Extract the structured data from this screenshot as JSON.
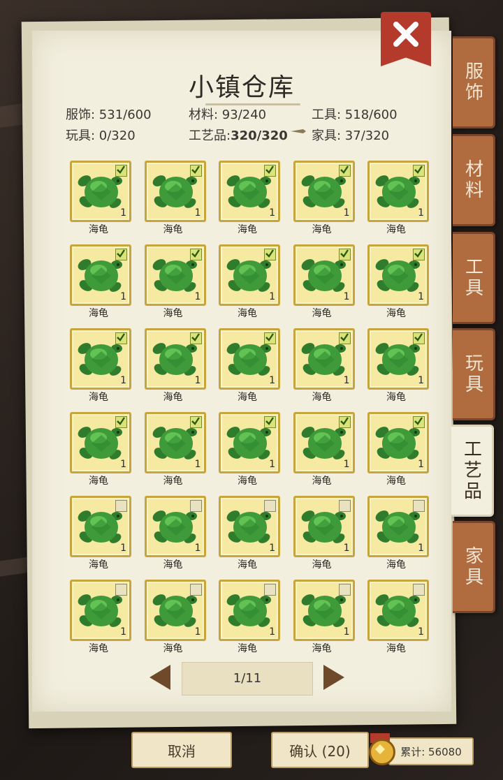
{
  "title": "小镇仓库",
  "stats": [
    {
      "name": "clothing",
      "text": "服饰: 531/600"
    },
    {
      "name": "materials",
      "text": "材料: 93/240"
    },
    {
      "name": "tools",
      "text": "工具: 518/600"
    },
    {
      "name": "toys",
      "text": "玩具: 0/320"
    },
    {
      "name": "crafts-label",
      "text": "工艺品:"
    },
    {
      "name": "crafts-value",
      "text": "320/320"
    },
    {
      "name": "furniture",
      "text": "家具: 37/320"
    }
  ],
  "tabs": [
    "服饰",
    "材料",
    "工具",
    "玩具",
    "工艺品",
    "家具"
  ],
  "active_tab": "工艺品",
  "items": [
    {
      "label": "海龟",
      "qty": "1",
      "checked": true
    },
    {
      "label": "海龟",
      "qty": "1",
      "checked": true
    },
    {
      "label": "海龟",
      "qty": "1",
      "checked": true
    },
    {
      "label": "海龟",
      "qty": "1",
      "checked": true
    },
    {
      "label": "海龟",
      "qty": "1",
      "checked": true
    },
    {
      "label": "海龟",
      "qty": "1",
      "checked": true
    },
    {
      "label": "海龟",
      "qty": "1",
      "checked": true
    },
    {
      "label": "海龟",
      "qty": "1",
      "checked": true
    },
    {
      "label": "海龟",
      "qty": "1",
      "checked": true
    },
    {
      "label": "海龟",
      "qty": "1",
      "checked": true
    },
    {
      "label": "海龟",
      "qty": "1",
      "checked": true
    },
    {
      "label": "海龟",
      "qty": "1",
      "checked": true
    },
    {
      "label": "海龟",
      "qty": "1",
      "checked": true
    },
    {
      "label": "海龟",
      "qty": "1",
      "checked": true
    },
    {
      "label": "海龟",
      "qty": "1",
      "checked": true
    },
    {
      "label": "海龟",
      "qty": "1",
      "checked": true
    },
    {
      "label": "海龟",
      "qty": "1",
      "checked": true
    },
    {
      "label": "海龟",
      "qty": "1",
      "checked": true
    },
    {
      "label": "海龟",
      "qty": "1",
      "checked": true
    },
    {
      "label": "海龟",
      "qty": "1",
      "checked": true
    },
    {
      "label": "海龟",
      "qty": "1",
      "checked": false
    },
    {
      "label": "海龟",
      "qty": "1",
      "checked": false
    },
    {
      "label": "海龟",
      "qty": "1",
      "checked": false
    },
    {
      "label": "海龟",
      "qty": "1",
      "checked": false
    },
    {
      "label": "海龟",
      "qty": "1",
      "checked": false
    },
    {
      "label": "海龟",
      "qty": "1",
      "checked": false
    },
    {
      "label": "海龟",
      "qty": "1",
      "checked": false
    },
    {
      "label": "海龟",
      "qty": "1",
      "checked": false
    },
    {
      "label": "海龟",
      "qty": "1",
      "checked": false
    },
    {
      "label": "海龟",
      "qty": "1",
      "checked": false
    }
  ],
  "pager": {
    "text": "1/11"
  },
  "buttons": {
    "cancel": "取消",
    "confirm": "确认 (20)"
  },
  "total": {
    "text": "累计: 56080"
  },
  "icons": {
    "close": "close-icon",
    "prev": "arrow-left-icon",
    "next": "arrow-right-icon",
    "item": "turtle-icon",
    "checkbox": "checkbox-icon",
    "medal": "medal-icon"
  },
  "colors": {
    "tab": "#b06c3f",
    "slot": "#f6e9a2",
    "slot_border": "#c7a43c",
    "close": "#b43a2c",
    "turtle": "#3f9a3a",
    "check_on": "#d9e37a"
  }
}
